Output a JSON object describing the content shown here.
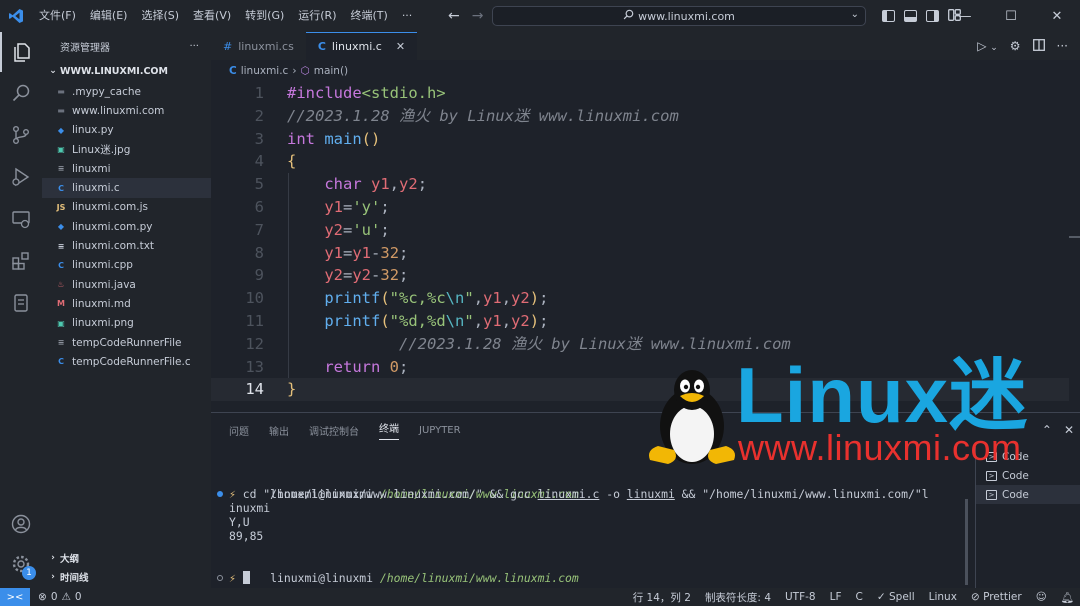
{
  "titlebar": {
    "menu": [
      "文件(F)",
      "编辑(E)",
      "选择(S)",
      "查看(V)",
      "转到(G)",
      "运行(R)",
      "终端(T)",
      "···"
    ],
    "command_center": "www.linuxmi.com",
    "window_controls": [
      "minimize-icon",
      "maximize-icon",
      "close-icon"
    ]
  },
  "activity_bar": {
    "items": [
      "explorer-icon",
      "search-icon",
      "source-control-icon",
      "run-debug-icon",
      "remote-explorer-icon",
      "extensions-icon",
      "testing-icon"
    ],
    "bottom": [
      "account-icon",
      "settings-gear-icon"
    ],
    "settings_badge": "1"
  },
  "sidebar": {
    "title": "资源管理器",
    "more": "···",
    "root": "WWW.LINUXMI.COM",
    "files": [
      {
        "name": ".mypy_cache",
        "icon": "folder",
        "color": "#6b717d"
      },
      {
        "name": "www.linuxmi.com",
        "icon": "folder",
        "color": "#6b717d"
      },
      {
        "name": "linux.py",
        "icon": "python",
        "color": "#3b8eea"
      },
      {
        "name": "Linux迷.jpg",
        "icon": "image",
        "color": "#4ec9b0"
      },
      {
        "name": "linuxmi",
        "icon": "file",
        "color": "#8b919c"
      },
      {
        "name": "linuxmi.c",
        "icon": "c",
        "color": "#3b8eea",
        "selected": true
      },
      {
        "name": "linuxmi.com.js",
        "icon": "js",
        "color": "#e5c07b"
      },
      {
        "name": "linuxmi.com.py",
        "icon": "python",
        "color": "#3b8eea"
      },
      {
        "name": "linuxmi.com.txt",
        "icon": "text",
        "color": "#c6ccd7"
      },
      {
        "name": "linuxmi.cpp",
        "icon": "cpp",
        "color": "#3b8eea"
      },
      {
        "name": "linuxmi.java",
        "icon": "java",
        "color": "#e06c75"
      },
      {
        "name": "linuxmi.md",
        "icon": "markdown",
        "color": "#e06c75"
      },
      {
        "name": "linuxmi.png",
        "icon": "image",
        "color": "#4ec9b0"
      },
      {
        "name": "tempCodeRunnerFile",
        "icon": "file",
        "color": "#8b919c"
      },
      {
        "name": "tempCodeRunnerFile.c",
        "icon": "c",
        "color": "#3b8eea"
      }
    ],
    "outline": "大纲",
    "timeline": "时间线"
  },
  "tabs": [
    {
      "label": "linuxmi.cs",
      "icon": "#",
      "active": false
    },
    {
      "label": "linuxmi.c",
      "icon": "C",
      "active": true
    }
  ],
  "breadcrumb": {
    "file": "linuxmi.c",
    "symbol": "main()"
  },
  "editor": {
    "current_line": 14,
    "lines": [
      {
        "n": "1",
        "tokens": [
          [
            "c-pre",
            "#include"
          ],
          [
            "c-str",
            "<stdio.h>"
          ]
        ]
      },
      {
        "n": "2",
        "tokens": [
          [
            "c-cmt",
            "//2023.1.28 渔火 by Linux迷 www.linuxmi.com"
          ]
        ]
      },
      {
        "n": "3",
        "tokens": [
          [
            "c-kw",
            "int "
          ],
          [
            "c-fn",
            "main"
          ],
          [
            "c-br",
            "()"
          ]
        ]
      },
      {
        "n": "4",
        "tokens": [
          [
            "c-br",
            "{"
          ]
        ]
      },
      {
        "n": "5",
        "tokens": [
          [
            "c-punc",
            "    "
          ],
          [
            "c-kw",
            "char "
          ],
          [
            "c-var",
            "y1"
          ],
          [
            "c-punc",
            ","
          ],
          [
            "c-var",
            "y2"
          ],
          [
            "c-punc",
            ";"
          ]
        ]
      },
      {
        "n": "6",
        "tokens": [
          [
            "c-punc",
            "    "
          ],
          [
            "c-var",
            "y1"
          ],
          [
            "c-punc",
            "="
          ],
          [
            "c-str",
            "'y'"
          ],
          [
            "c-punc",
            ";"
          ]
        ]
      },
      {
        "n": "7",
        "tokens": [
          [
            "c-punc",
            "    "
          ],
          [
            "c-var",
            "y2"
          ],
          [
            "c-punc",
            "="
          ],
          [
            "c-str",
            "'u'"
          ],
          [
            "c-punc",
            ";"
          ]
        ]
      },
      {
        "n": "8",
        "tokens": [
          [
            "c-punc",
            "    "
          ],
          [
            "c-var",
            "y1"
          ],
          [
            "c-punc",
            "="
          ],
          [
            "c-var",
            "y1"
          ],
          [
            "c-punc",
            "-"
          ],
          [
            "c-num",
            "32"
          ],
          [
            "c-punc",
            ";"
          ]
        ]
      },
      {
        "n": "9",
        "tokens": [
          [
            "c-punc",
            "    "
          ],
          [
            "c-var",
            "y2"
          ],
          [
            "c-punc",
            "="
          ],
          [
            "c-var",
            "y2"
          ],
          [
            "c-punc",
            "-"
          ],
          [
            "c-num",
            "32"
          ],
          [
            "c-punc",
            ";"
          ]
        ]
      },
      {
        "n": "10",
        "tokens": [
          [
            "c-punc",
            "    "
          ],
          [
            "c-fn",
            "printf"
          ],
          [
            "c-br",
            "("
          ],
          [
            "c-str",
            "\"%c,%c"
          ],
          [
            "c-esc",
            "\\n"
          ],
          [
            "c-str",
            "\""
          ],
          [
            "c-punc",
            ","
          ],
          [
            "c-var",
            "y1"
          ],
          [
            "c-punc",
            ","
          ],
          [
            "c-var",
            "y2"
          ],
          [
            "c-br",
            ")"
          ],
          [
            "c-punc",
            ";"
          ]
        ]
      },
      {
        "n": "11",
        "tokens": [
          [
            "c-punc",
            "    "
          ],
          [
            "c-fn",
            "printf"
          ],
          [
            "c-br",
            "("
          ],
          [
            "c-str",
            "\"%d,%d"
          ],
          [
            "c-esc",
            "\\n"
          ],
          [
            "c-str",
            "\""
          ],
          [
            "c-punc",
            ","
          ],
          [
            "c-var",
            "y1"
          ],
          [
            "c-punc",
            ","
          ],
          [
            "c-var",
            "y2"
          ],
          [
            "c-br",
            ")"
          ],
          [
            "c-punc",
            ";"
          ]
        ]
      },
      {
        "n": "12",
        "tokens": [
          [
            "c-punc",
            "            "
          ],
          [
            "c-cmt",
            "//2023.1.28 渔火 by Linux迷 www.linuxmi.com"
          ]
        ]
      },
      {
        "n": "13",
        "tokens": [
          [
            "c-punc",
            "    "
          ],
          [
            "c-kw",
            "return "
          ],
          [
            "c-num",
            "0"
          ],
          [
            "c-punc",
            ";"
          ]
        ]
      },
      {
        "n": "14",
        "tokens": [
          [
            "c-br",
            "}"
          ]
        ]
      }
    ]
  },
  "panel": {
    "tabs": [
      "问题",
      "输出",
      "调试控制台",
      "终端",
      "JUPYTER"
    ],
    "active_tab": "终端",
    "actions": [
      "maximize-panel-icon",
      "chevron-up-icon",
      "close-icon"
    ],
    "terminal": {
      "prompt_user": "linuxmi@linuxmi",
      "prompt_path": "/home/linuxmi/www.linuxmi.com",
      "cmd_symbol": "⚡",
      "cmd_part1": " cd ",
      "cmd_path1": "\"/home/linuxmi/www.linuxmi.com/\"",
      "cmd_and1": " && gcc ",
      "cmd_src": "linuxmi.c",
      "cmd_o": " -o ",
      "cmd_out": "linuxmi",
      "cmd_and2": " && ",
      "cmd_path2": "\"/home/linuxmi/www.linuxmi.com/\"l",
      "cmd_wrap": "inuxmi",
      "output": [
        "Y,U",
        "89,85"
      ]
    },
    "terminal_list": [
      "Code",
      "Code",
      "Code"
    ]
  },
  "statusbar": {
    "errors": "0",
    "warnings": "0",
    "position": "行 14，列 2",
    "tab_size": "制表符长度: 4",
    "encoding": "UTF-8",
    "eol": "LF",
    "language": "C",
    "spell": "Spell",
    "platform": "Linux",
    "prettier": "Prettier"
  },
  "watermark": {
    "title": "Linux迷",
    "url": "www.linuxmi.com"
  },
  "colors": {
    "accent": "#3b8eea",
    "background": "#1e222a",
    "chrome": "#21252b"
  }
}
